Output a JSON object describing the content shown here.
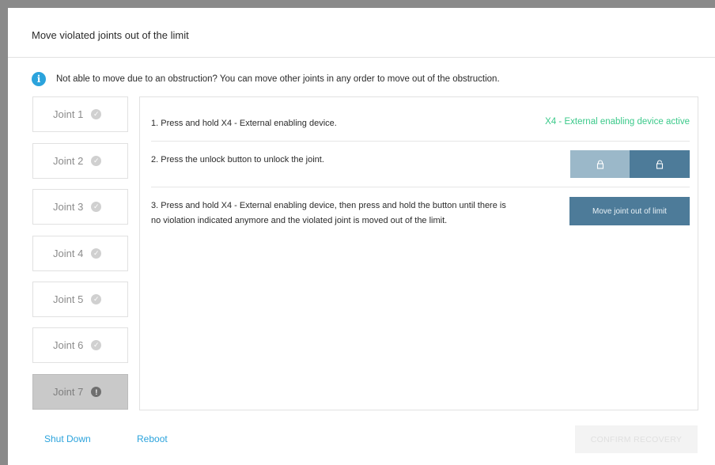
{
  "dialog": {
    "title": "Move violated joints out of the limit",
    "info_text": "Not able to move due to an obstruction? You can move other joints in any order to move out of the obstruction."
  },
  "joints": [
    {
      "label": "Joint 1",
      "status": "ok"
    },
    {
      "label": "Joint 2",
      "status": "ok"
    },
    {
      "label": "Joint 3",
      "status": "ok"
    },
    {
      "label": "Joint 4",
      "status": "ok"
    },
    {
      "label": "Joint 5",
      "status": "ok"
    },
    {
      "label": "Joint 6",
      "status": "ok"
    },
    {
      "label": "Joint 7",
      "status": "violated"
    }
  ],
  "steps": {
    "step1": "1. Press and hold X4 - External enabling device.",
    "step1_status": "X4 - External enabling device active",
    "step2": "2. Press the unlock button to unlock the joint.",
    "step3_line1": "3. Press and hold X4 - External enabling device, then press and hold the button until there is",
    "step3_line2": "no violation indicated anymore and the violated joint is moved out of the limit.",
    "move_button": "Move joint out of limit"
  },
  "footer": {
    "shutdown": "Shut Down",
    "reboot": "Reboot",
    "confirm": "CONFIRM RECOVERY"
  },
  "colors": {
    "accent": "#2ba3dc",
    "active_status": "#3bc98a",
    "button": "#4d7b99",
    "button_light": "#9bb8c9"
  },
  "icons": {
    "info": "info-icon",
    "ok": "check-icon",
    "violated": "exclamation-icon",
    "lock": "lock-icon",
    "unlock": "unlock-icon"
  }
}
